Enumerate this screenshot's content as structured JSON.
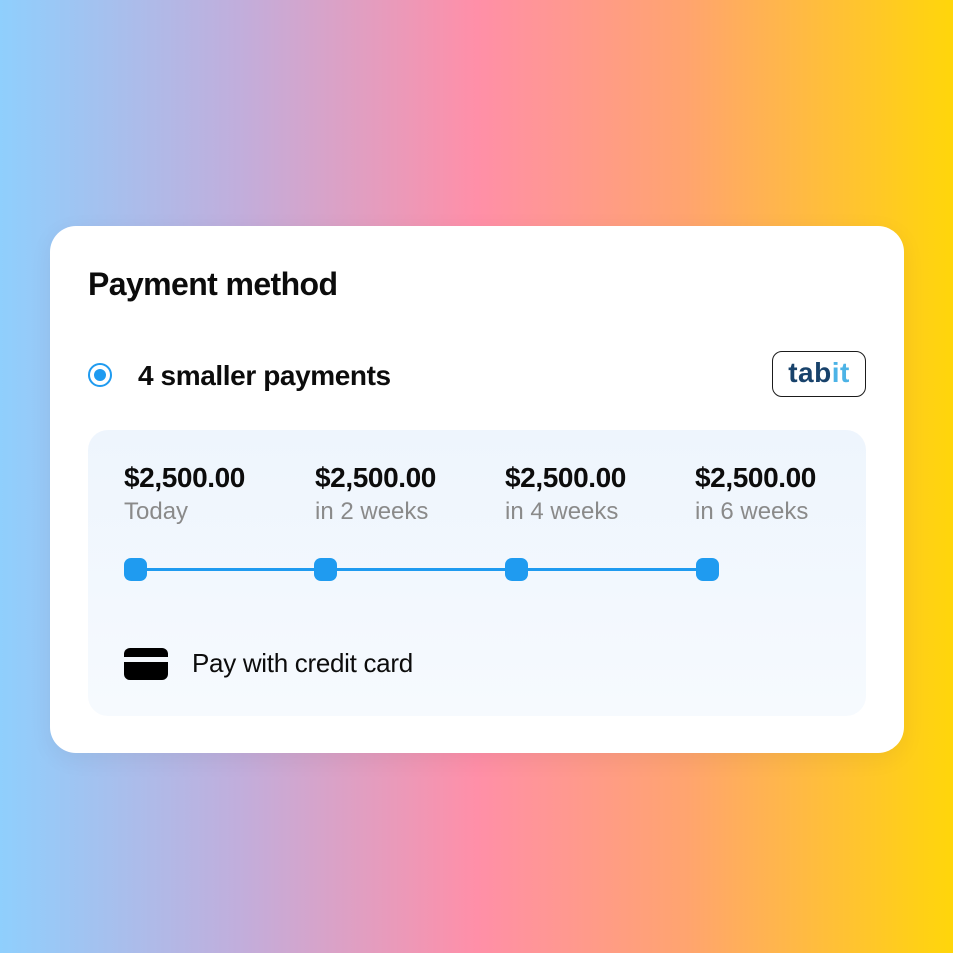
{
  "card": {
    "title": "Payment method"
  },
  "option": {
    "label": "4 smaller payments",
    "selected": true,
    "brand": {
      "part1": "tab",
      "part2": "it",
      "color_dark": "#18426b",
      "color_light": "#4cb3e6"
    }
  },
  "schedule": {
    "installments": [
      {
        "amount": "$2,500.00",
        "when": "Today"
      },
      {
        "amount": "$2,500.00",
        "when": "in 2 weeks"
      },
      {
        "amount": "$2,500.00",
        "when": "in 4 weeks"
      },
      {
        "amount": "$2,500.00",
        "when": "in 6 weeks"
      }
    ],
    "accent_color": "#1f9bf0"
  },
  "payment_source": {
    "label": "Pay with credit card",
    "icon": "credit-card-icon"
  }
}
